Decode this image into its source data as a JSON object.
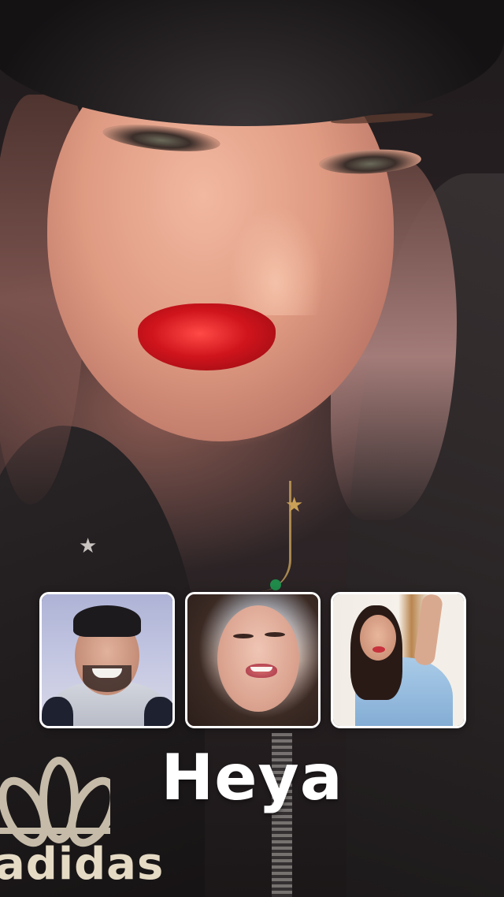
{
  "app": {
    "title": "Heya"
  },
  "background": {
    "description_icon": "live-video-frame",
    "brand_text": "adidas"
  },
  "thumbnails": [
    {
      "name": "thumbnail-man-smiling",
      "icon": "person-thumbnail"
    },
    {
      "name": "thumbnail-woman-smiling",
      "icon": "person-thumbnail"
    },
    {
      "name": "thumbnail-woman-posing",
      "icon": "person-thumbnail"
    }
  ],
  "colors": {
    "title": "#ffffff",
    "thumb_border": "#ffffff",
    "lip_red": "#d0141c"
  }
}
